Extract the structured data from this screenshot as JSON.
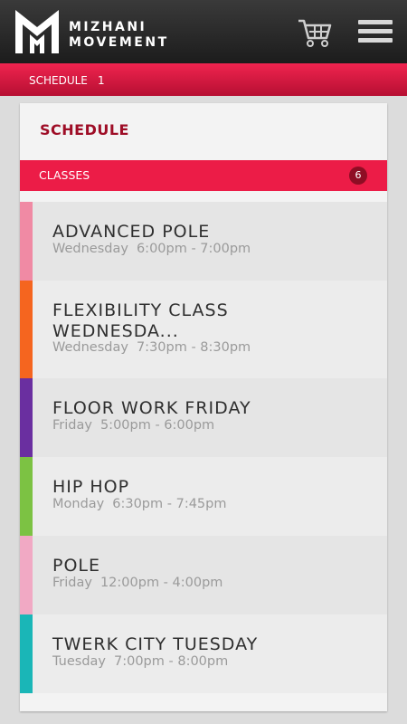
{
  "header": {
    "brand_line1": "MIZHANI",
    "brand_line2": "MOVEMENT",
    "cart_icon": "shopping-cart-icon",
    "menu_icon": "hamburger-menu-icon"
  },
  "breadcrumb": {
    "label": "SCHEDULE",
    "count": "1"
  },
  "card": {
    "title": "SCHEDULE",
    "section_label": "CLASSES",
    "section_count": "6"
  },
  "classes": [
    {
      "name": "ADVANCED POLE",
      "day": "Wednesday",
      "time": "6:00pm - 7:00pm",
      "color": "#f08aa4",
      "bg": "#e5e5e5"
    },
    {
      "name": "FLEXIBILITY CLASS WEDNESDA...",
      "day": "Wednesday",
      "time": "7:30pm - 8:30pm",
      "color": "#f5651f",
      "bg": "#ececec"
    },
    {
      "name": "FLOOR WORK FRIDAY",
      "day": "Friday",
      "time": "5:00pm - 6:00pm",
      "color": "#6a2fa0",
      "bg": "#e5e5e5"
    },
    {
      "name": "HIP HOP",
      "day": "Monday",
      "time": "6:30pm - 7:45pm",
      "color": "#7cc243",
      "bg": "#ececec"
    },
    {
      "name": "POLE",
      "day": "Friday",
      "time": "12:00pm - 4:00pm",
      "color": "#f1a9c4",
      "bg": "#e5e5e5"
    },
    {
      "name": "TWERK CITY TUESDAY",
      "day": "Tuesday",
      "time": "7:00pm - 8:00pm",
      "color": "#1ab6b7",
      "bg": "#ececec"
    }
  ],
  "colors": {
    "accent": "#ec1c47",
    "title_red": "#9e0d26"
  }
}
